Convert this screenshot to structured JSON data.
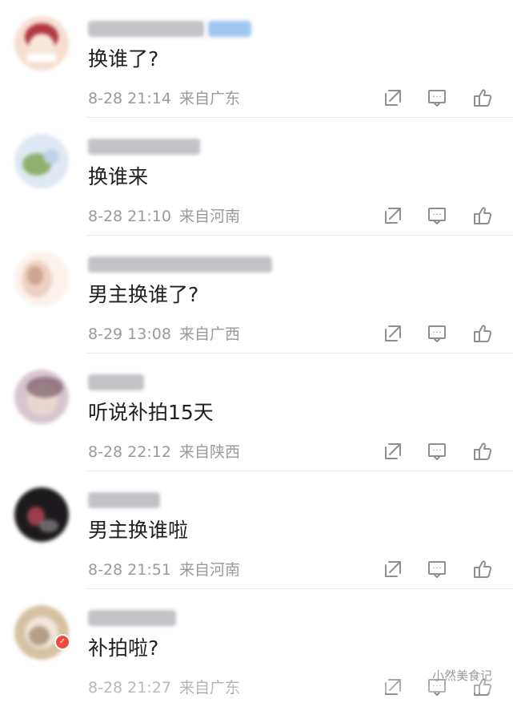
{
  "comments": [
    {
      "text": "换谁了?",
      "time": "8-28 21:14",
      "location": "来自广东",
      "avatar_color_1": "#f7d6c5",
      "avatar_color_2": "#aa2a34",
      "avatar_color_3": "#f5e8d8"
    },
    {
      "text": "换谁来",
      "time": "8-28 21:10",
      "location": "来自河南",
      "avatar_color_1": "#dfe8f3",
      "avatar_color_2": "#8eb16e",
      "avatar_color_3": "#bcd4ec"
    },
    {
      "text": "男主换谁了?",
      "time": "8-29 13:08",
      "location": "来自广西",
      "avatar_color_1": "#f0d0c2",
      "avatar_color_2": "#b0826b",
      "avatar_color_3": "#fbf2ec"
    },
    {
      "text": "听说补拍15天",
      "time": "8-28 22:12",
      "location": "来自陕西",
      "avatar_color_1": "#e7d7ce",
      "avatar_color_2": "#7b5c66",
      "avatar_color_3": "#d7c6d0"
    },
    {
      "text": "男主换谁啦",
      "time": "8-28 21:51",
      "location": "来自河南",
      "avatar_color_1": "#1d1a1d",
      "avatar_color_2": "#b54557",
      "avatar_color_3": "#7d7a7d"
    },
    {
      "text": "补拍啦?",
      "time": "8-28 21:27",
      "location": "来自广东",
      "avatar_color_1": "#d6c1a2",
      "avatar_color_2": "#8c7454",
      "avatar_color_3": "#f5ede4"
    }
  ],
  "icons": {
    "share": "share-icon",
    "reply": "comment-icon",
    "like": "thumbs-up-icon"
  },
  "watermark": "小然美食记"
}
